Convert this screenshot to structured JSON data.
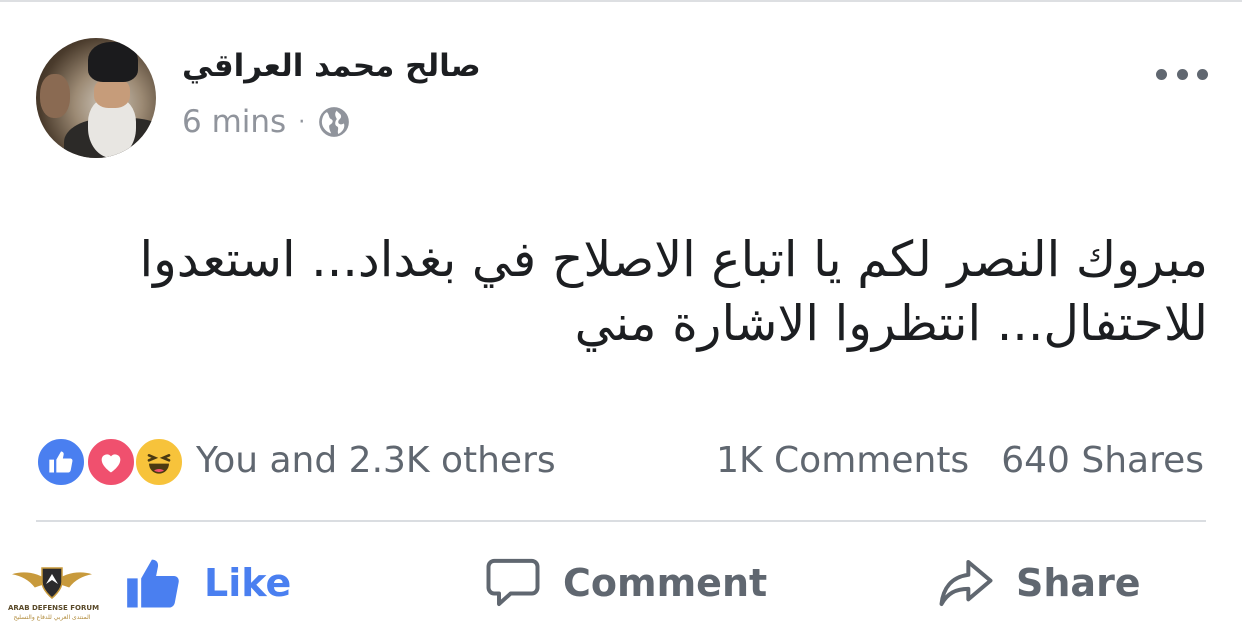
{
  "author": {
    "name": "صالح محمد العراقي",
    "time": "6 mins",
    "separator": "·",
    "audience_icon": "globe-icon"
  },
  "post": {
    "text": "مبروك النصر لكم يا اتباع الاصلاح في بغداد... استعدوا للاحتفال... انتظروا الاشارة مني"
  },
  "reactions": {
    "icons": [
      "like-reaction-icon",
      "love-reaction-icon",
      "haha-reaction-icon"
    ],
    "summary": "You and 2.3K others"
  },
  "counts": {
    "comments": "1K Comments",
    "shares": "640 Shares"
  },
  "actions": {
    "like_label": "Like",
    "comment_label": "Comment",
    "share_label": "Share"
  },
  "watermark": {
    "line1": "ARAB DEFENSE FORUM",
    "line2": "المنتدى العربي للدفاع والتسليح"
  },
  "colors": {
    "accent": "#4a7ff0",
    "muted": "#606770",
    "love": "#f0506e",
    "haha": "#f7c33b"
  }
}
